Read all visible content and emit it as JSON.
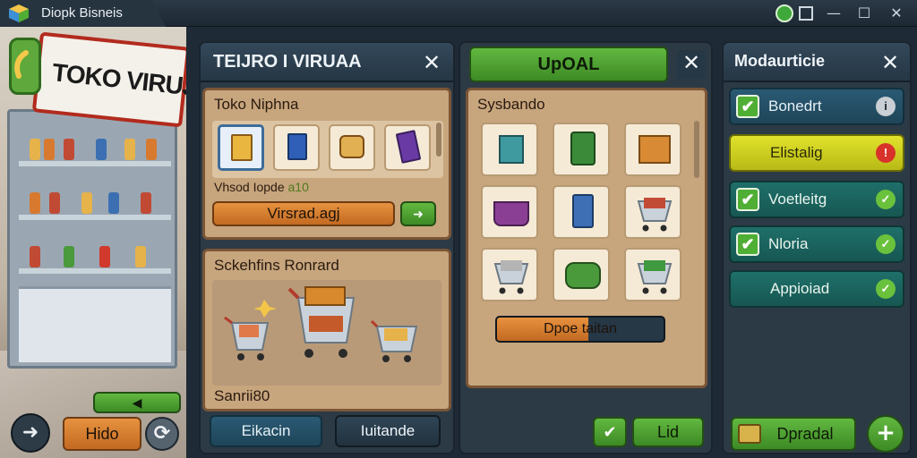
{
  "window": {
    "title": "Diopk Bisneis",
    "controls": {
      "minimize": "—",
      "restore": "☐",
      "close": "✕"
    },
    "status_icon": "green-circle-icon",
    "status_icon_color": "#3fa83a"
  },
  "scene": {
    "sign_text": "TOKO VIRUJA",
    "small_button_arrow": "◀",
    "bottom": {
      "back_arrow": "➜",
      "primary_button": "Hido",
      "refresh_icon": "⟳"
    }
  },
  "left_panel": {
    "title": "TEIJRO I VIRUAA",
    "close": "✕",
    "top_card": {
      "title": "Toko Niphna",
      "subtitle": "Vhsod Iopde",
      "subtitle_value": "a10",
      "action_label": "Virsrad.agj",
      "action_arrow": "➜",
      "items": [
        {
          "icon": "cereal-box-icon",
          "color": "#e9b640"
        },
        {
          "icon": "blue-box-icon",
          "color": "#2f5fb7"
        },
        {
          "icon": "snack-bag-icon",
          "color": "#e0b052"
        },
        {
          "icon": "purple-box-icon",
          "color": "#6a3aa4"
        }
      ]
    },
    "bottom_card": {
      "title": "Sckehfins Ronrard",
      "footer": "Sanrii80",
      "carts": [
        "shopping-cart-icon",
        "shopping-cart-icon",
        "shopping-cart-icon"
      ]
    },
    "bottom_buttons": {
      "left": "Eikacin",
      "right": "Iuitande"
    }
  },
  "middle_panel": {
    "title": "UpOAL",
    "close": "✕",
    "card_title": "Sysbando",
    "progress_label": "Dpoe taitan",
    "progress_fraction": 0.55,
    "grid_items": [
      {
        "icon": "teal-box-icon",
        "color": "#3f9aa0"
      },
      {
        "icon": "green-bag-icon",
        "color": "#3a8a3a"
      },
      {
        "icon": "crate-icon",
        "color": "#d88a34"
      },
      {
        "icon": "basket-icon",
        "color": "#8a3f94"
      },
      {
        "icon": "blue-bag-icon",
        "color": "#3e6fb5"
      },
      {
        "icon": "shopping-cart-icon",
        "color": "#c24b36"
      },
      {
        "icon": "shopping-cart-icon",
        "color": "#b4b4b4"
      },
      {
        "icon": "green-package-icon",
        "color": "#4a9a3c"
      },
      {
        "icon": "shopping-cart-icon",
        "color": "#3f9a3f"
      }
    ],
    "confirm_check": "✔",
    "confirm_label": "Lid"
  },
  "right_panel": {
    "title": "Modaurticie",
    "close": "✕",
    "options": [
      {
        "label": "Bonedrt",
        "checked": true,
        "indicator": "i",
        "style": "blue"
      },
      {
        "label": "Elistalig",
        "checked": false,
        "indicator": "!",
        "style": "yellow"
      },
      {
        "label": "Voetleitg",
        "checked": true,
        "indicator": "✓",
        "style": "teal"
      },
      {
        "label": "Nloria",
        "checked": true,
        "indicator": "✓",
        "style": "teal"
      },
      {
        "label": "Appioiad",
        "checked": false,
        "indicator": "✓",
        "style": "teal"
      }
    ],
    "bottom_button": "Dpradal",
    "plus": "+"
  }
}
